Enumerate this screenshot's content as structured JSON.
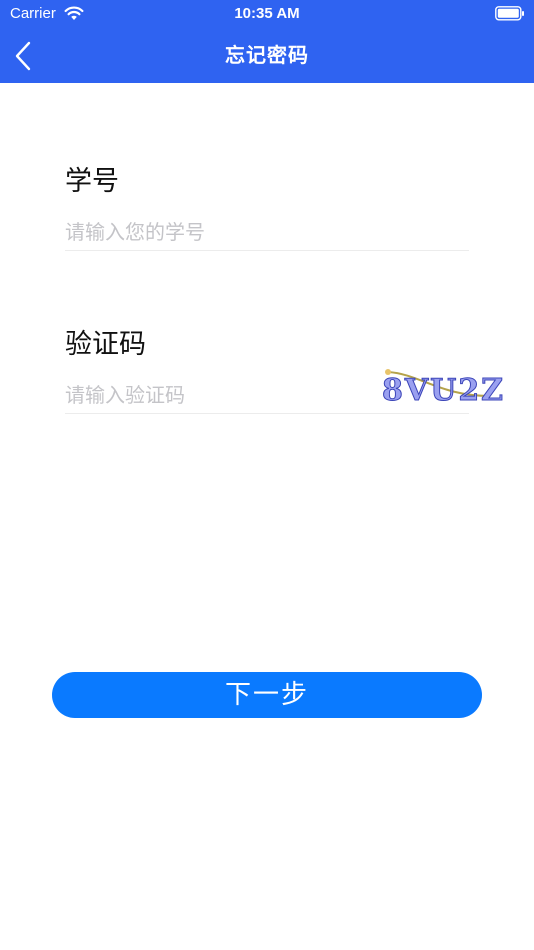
{
  "status_bar": {
    "carrier": "Carrier",
    "time": "10:35 AM",
    "wifi_icon": "wifi-icon",
    "battery_icon": "battery-icon"
  },
  "nav": {
    "title": "忘记密码",
    "back_icon": "chevron-left-icon"
  },
  "form": {
    "student_id": {
      "label": "学号",
      "placeholder": "请输入您的学号",
      "value": ""
    },
    "captcha": {
      "label": "验证码",
      "placeholder": "请输入验证码",
      "value": "",
      "image_text": "8VU2Z"
    }
  },
  "next_button": {
    "label": "下一步"
  },
  "colors": {
    "header": "#2f63f1",
    "button": "#0a7aff",
    "placeholder": "#c4c4c8",
    "divider": "#ececec"
  }
}
